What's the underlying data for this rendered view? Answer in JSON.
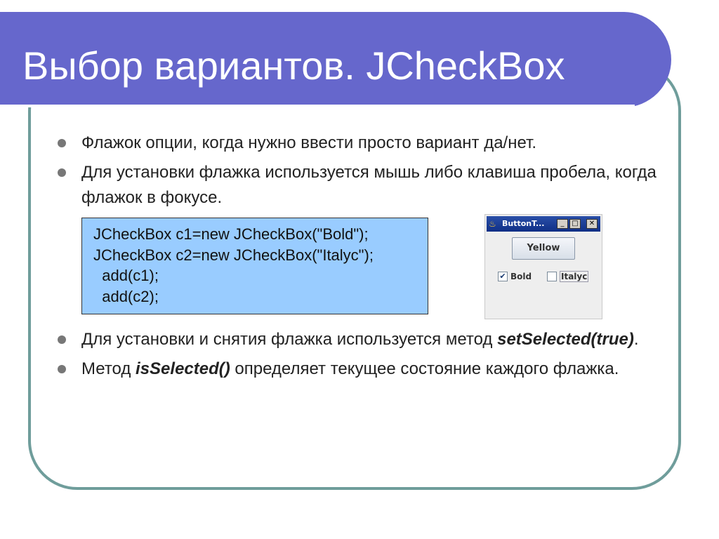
{
  "slide": {
    "title": "Выбор вариантов. JCheckBox",
    "bullets_top": [
      "Флажок опции, когда нужно ввести просто вариант да/нет.",
      "Для установки флажка используется мышь либо клавиша пробела, когда флажок в фокусе."
    ],
    "code_lines": [
      "JCheckBox c1=new JCheckBox(\"Bold\");",
      "JCheckBox c2=new JCheckBox(\"Italyc\");",
      "  add(c1);",
      "  add(c2);"
    ],
    "bullet3": {
      "text_before": "Для установки и снятия флажка используется метод ",
      "method": "setSelected(true)",
      "text_after": "."
    },
    "bullet4": {
      "text_before": "Метод ",
      "method": "isSelected()",
      "text_after": " определяет текущее состояние каждого флажка."
    }
  },
  "java_window": {
    "title": "ButtonT...",
    "minimize": "_",
    "maximize": "□",
    "close": "✕",
    "button_label": "Yellow",
    "checkbox1": {
      "label": "Bold",
      "checked": true,
      "mark": "✔"
    },
    "checkbox2": {
      "label": "Italyc",
      "checked": false,
      "mark": ""
    }
  },
  "colors": {
    "title_bar": "#6667cc",
    "frame_border": "#6f9d9b",
    "code_background": "#99ccff"
  }
}
